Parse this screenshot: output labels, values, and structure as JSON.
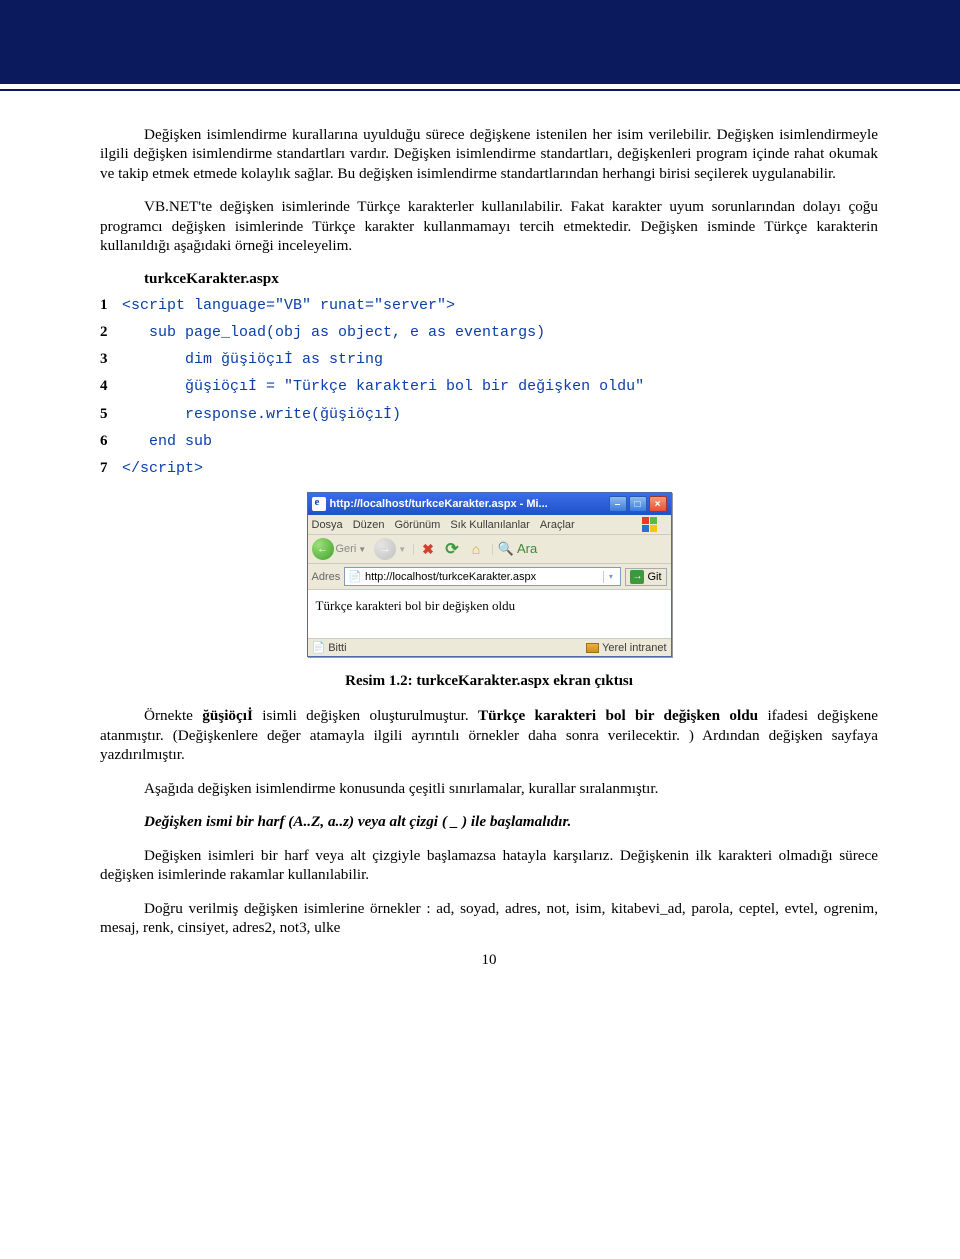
{
  "paragraphs": {
    "p1": "Değişken isimlendirme kurallarına uyulduğu sürece değişkene istenilen her isim verilebilir. Değişken isimlendirmeyle ilgili değişken isimlendirme standartları vardır. Değişken isimlendirme standartları, değişkenleri program içinde rahat okumak ve takip etmek etmede kolaylık sağlar. Bu değişken isimlendirme standartlarından herhangi birisi seçilerek uygulanabilir.",
    "p2": "VB.NET'te değişken isimlerinde Türkçe karakterler kullanılabilir. Fakat karakter uyum sorunlarından dolayı çoğu programcı değişken isimlerinde Türkçe karakter kullanmamayı tercih etmektedir. Değişken isminde Türkçe karakterin kullanıldığı aşağıdaki örneği inceleyelim.",
    "p3_a": "Örnekte ",
    "p3_b": "ğüşiöçıİ",
    "p3_c": " isimli değişken oluşturulmuştur. ",
    "p3_d": "Türkçe karakteri bol bir değişken oldu",
    "p3_e": " ifadesi değişkene atanmıştır. (Değişkenlere değer atamayla ilgili ayrıntılı örnekler daha sonra verilecektir. ) Ardından değişken sayfaya yazdırılmıştır.",
    "p4": "Aşağıda değişken isimlendirme konusunda çeşitli sınırlamalar, kurallar sıralanmıştır.",
    "p5": "Değişken ismi bir harf (A..Z, a..z) veya alt çizgi ( _ ) ile başlamalıdır.",
    "p6": "Değişken isimleri bir harf veya alt çizgiyle başlamazsa hatayla karşılarız. Değişkenin ilk karakteri olmadığı sürece değişken isimlerinde rakamlar kullanılabilir.",
    "p7": "Doğru verilmiş değişken isimlerine örnekler : ad, soyad, adres, not, isim, kitabevi_ad, parola, ceptel, evtel, ogrenim, mesaj, renk, cinsiyet, adres2, not3, ulke"
  },
  "filename": "turkceKarakter.aspx",
  "code": {
    "l1": "<script language=\"VB\" runat=\"server\">",
    "l2": "   sub page_load(obj as object, e as eventargs)",
    "l3": "       dim ğüşiöçıİ as string",
    "l4": "       ğüşiöçıİ = \"Türkçe karakteri bol bir değişken oldu\"",
    "l5": "       response.write(ğüşiöçıİ)",
    "l6": "   end sub",
    "l7": "</script>"
  },
  "ie": {
    "title": "http://localhost/turkceKarakter.aspx - Mi...",
    "menu": {
      "dosya": "Dosya",
      "duzen": "Düzen",
      "gorunum": "Görünüm",
      "sik": "Sık Kullanılanlar",
      "araclar": "Araçlar"
    },
    "back": "Geri",
    "search": "Ara",
    "addr_label": "Adres",
    "url": "http://localhost/turkceKarakter.aspx",
    "go": "Git",
    "content": "Türkçe karakteri bol bir değişken oldu",
    "done": "Bitti",
    "zone": "Yerel intranet"
  },
  "caption": "Resim 1.2: turkceKarakter.aspx ekran çıktısı",
  "page_number": "10"
}
